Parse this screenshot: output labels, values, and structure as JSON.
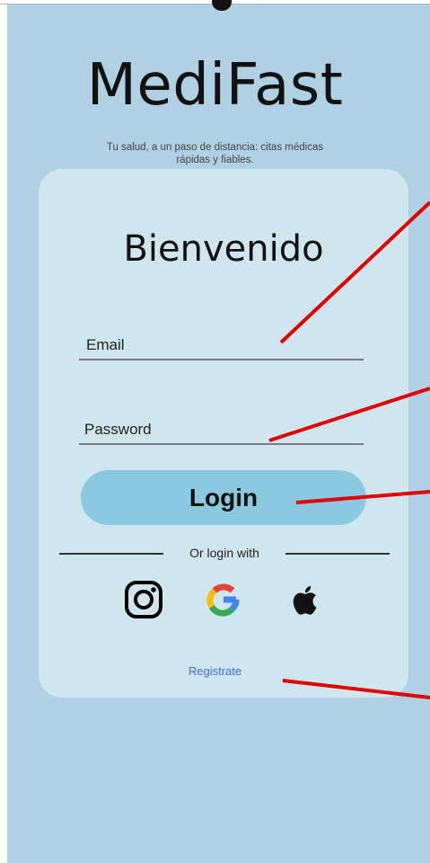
{
  "app": {
    "title": "MediFast",
    "tagline": "Tu salud, a un paso de distancia: citas médicas rápidas y fiables."
  },
  "card": {
    "heading": "Bienvenido",
    "email_label": "Email",
    "password_label": "Password",
    "login_label": "Login",
    "divider_text": "Or login with",
    "register_link": "Registrate"
  },
  "social": [
    {
      "name": "instagram-icon"
    },
    {
      "name": "google-icon"
    },
    {
      "name": "apple-icon"
    }
  ],
  "colors": {
    "background": "#afd1e3",
    "card": "#d0e6ef",
    "button": "#8ac9df",
    "link": "#3f6be0",
    "annotation": "#e00000"
  }
}
